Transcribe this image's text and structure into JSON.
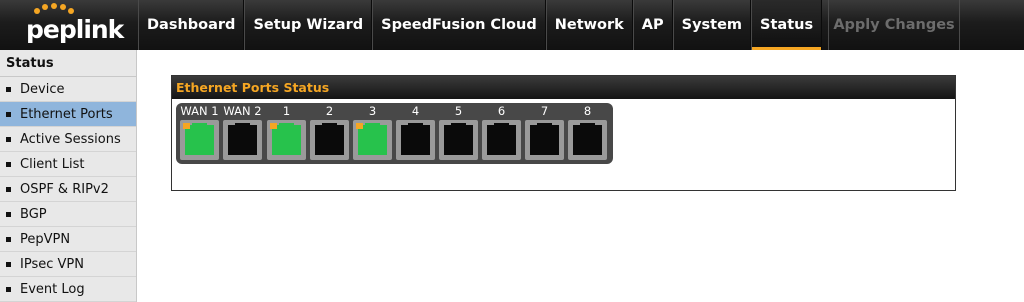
{
  "brand": {
    "name": "peplink",
    "accent": "#f5a623"
  },
  "nav": {
    "items": [
      {
        "label": "Dashboard"
      },
      {
        "label": "Setup Wizard"
      },
      {
        "label": "SpeedFusion Cloud"
      },
      {
        "label": "Network"
      },
      {
        "label": "AP"
      },
      {
        "label": "System"
      },
      {
        "label": "Status"
      }
    ],
    "active": "Status",
    "apply_label": "Apply Changes"
  },
  "sidebar": {
    "heading": "Status",
    "items": [
      {
        "label": "Device"
      },
      {
        "label": "Ethernet Ports"
      },
      {
        "label": "Active Sessions"
      },
      {
        "label": "Client List"
      },
      {
        "label": "OSPF & RIPv2"
      },
      {
        "label": "BGP"
      },
      {
        "label": "PepVPN"
      },
      {
        "label": "IPsec VPN"
      },
      {
        "label": "Event Log"
      }
    ],
    "active": "Ethernet Ports"
  },
  "panel": {
    "title": "Ethernet Ports Status",
    "ports": [
      {
        "label": "WAN 1",
        "link_up": true
      },
      {
        "label": "WAN 2",
        "link_up": false
      },
      {
        "label": "1",
        "link_up": true
      },
      {
        "label": "2",
        "link_up": false
      },
      {
        "label": "3",
        "link_up": true
      },
      {
        "label": "4",
        "link_up": false
      },
      {
        "label": "5",
        "link_up": false
      },
      {
        "label": "6",
        "link_up": false
      },
      {
        "label": "7",
        "link_up": false
      },
      {
        "label": "8",
        "link_up": false
      }
    ]
  },
  "colors": {
    "link_up": "#27c24c",
    "link_down": "#0a0a0a",
    "active_sidebar": "#8fb5dc"
  }
}
